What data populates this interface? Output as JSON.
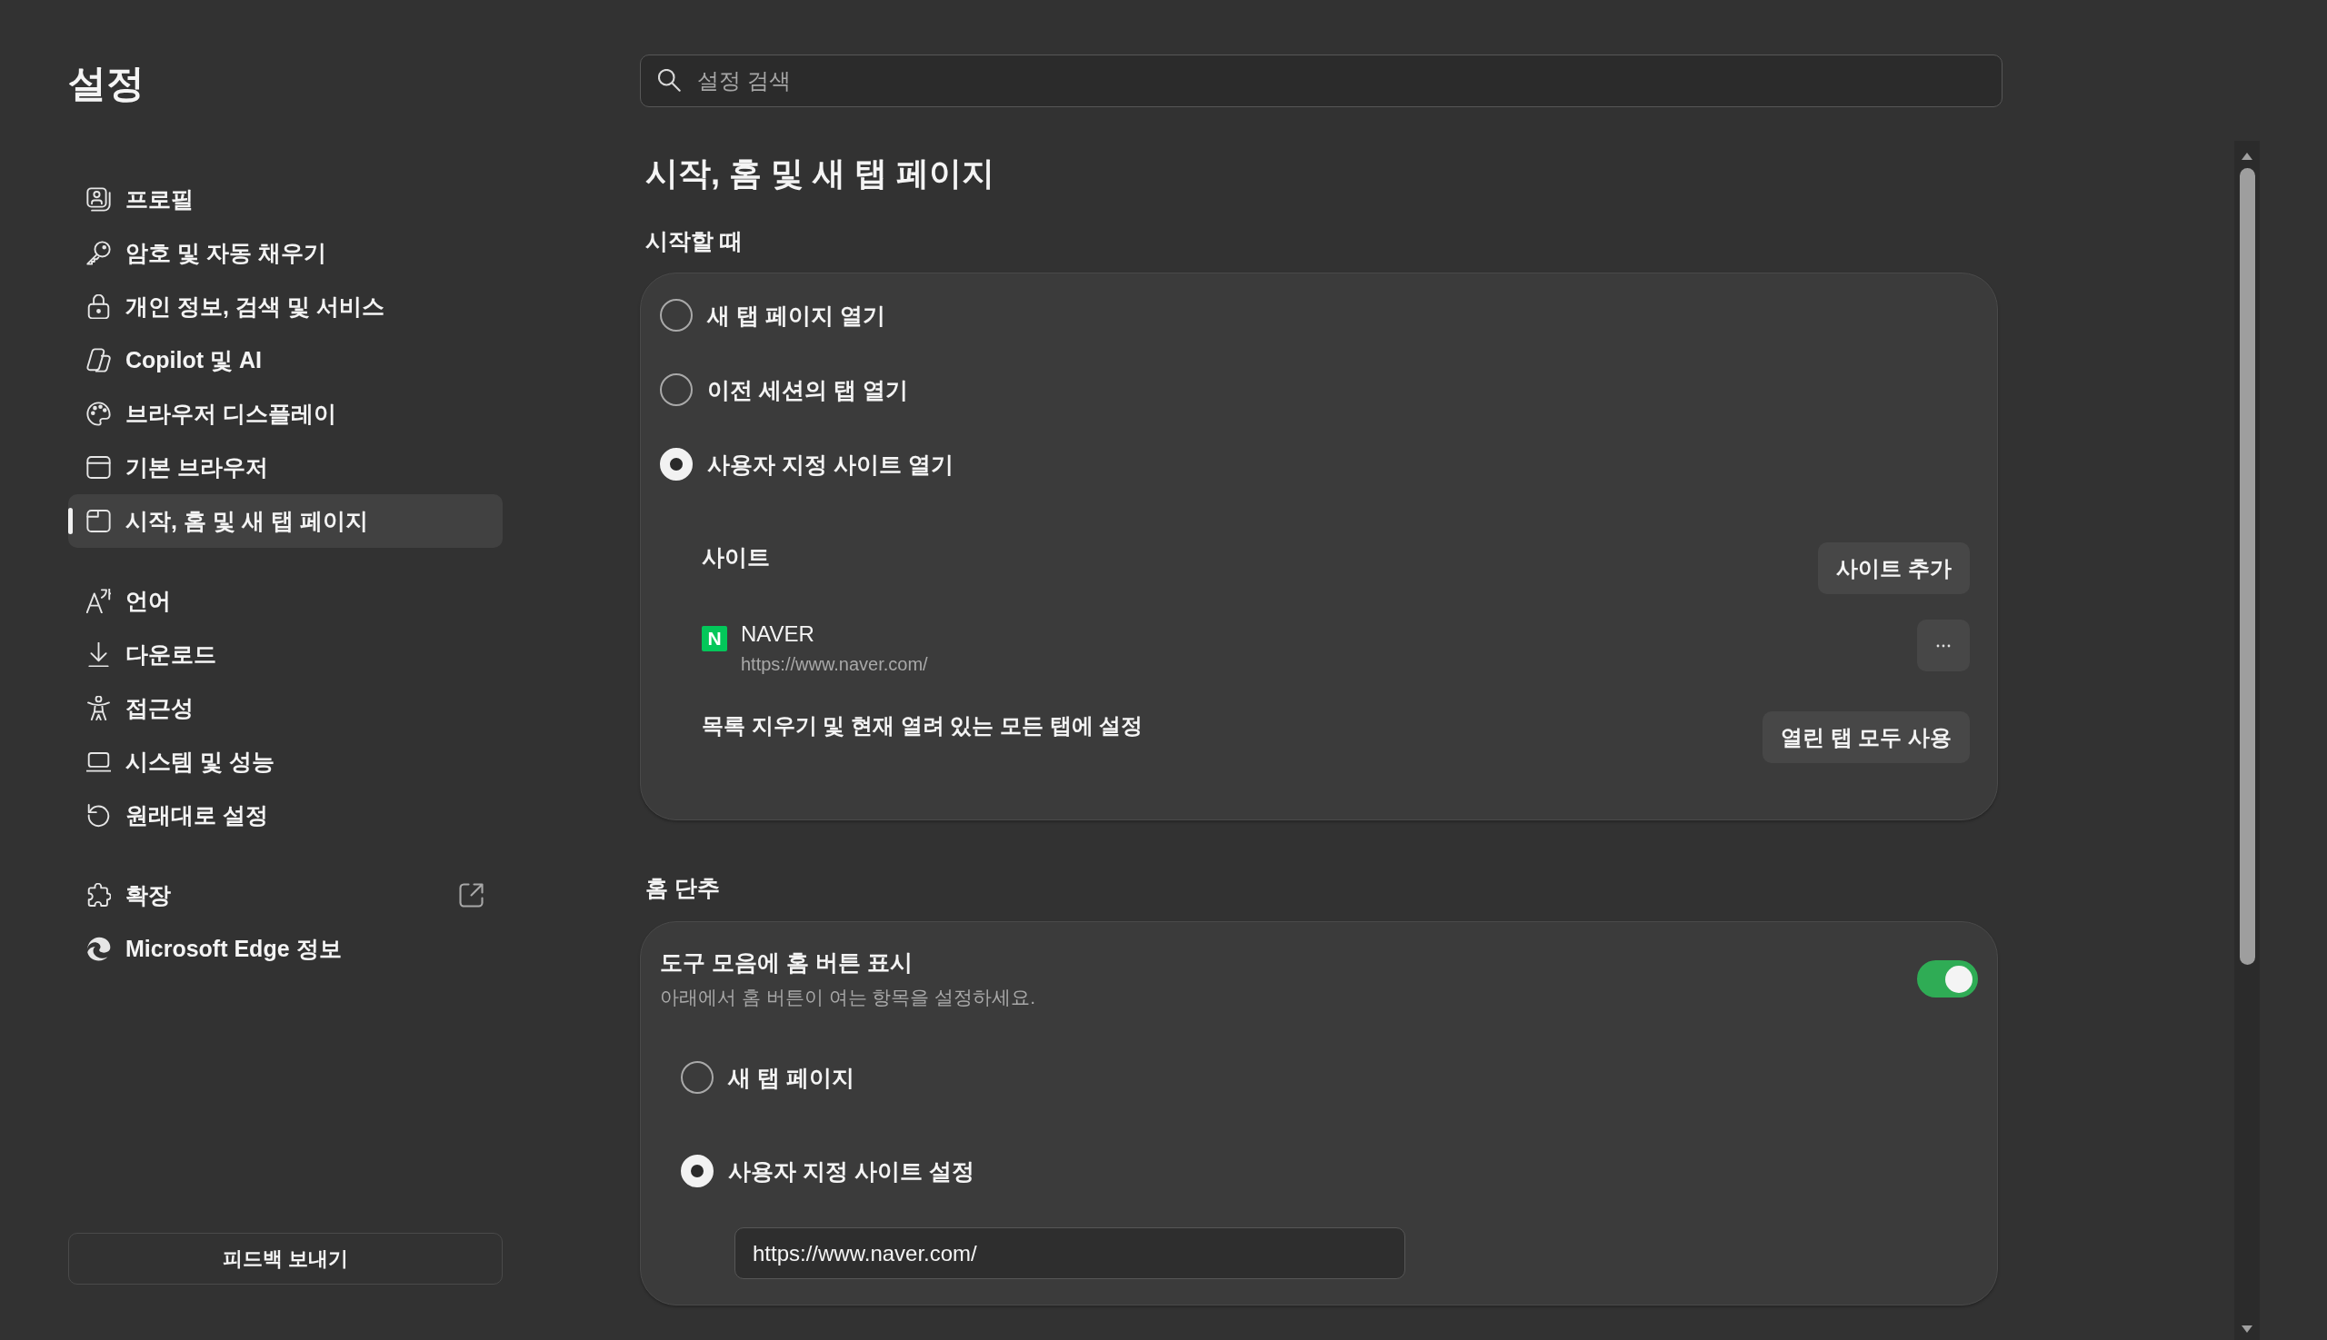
{
  "sidebar": {
    "title": "설정",
    "groups": [
      {
        "items": [
          {
            "label": "프로필",
            "selected": false,
            "external": false
          },
          {
            "label": "암호 및 자동 채우기",
            "selected": false,
            "external": false
          },
          {
            "label": "개인 정보, 검색 및 서비스",
            "selected": false,
            "external": false
          },
          {
            "label": "Copilot 및 AI",
            "selected": false,
            "external": false
          },
          {
            "label": "브라우저 디스플레이",
            "selected": false,
            "external": false
          },
          {
            "label": "기본 브라우저",
            "selected": false,
            "external": false
          },
          {
            "label": "시작, 홈 및 새 탭 페이지",
            "selected": true,
            "external": false
          }
        ]
      },
      {
        "items": [
          {
            "label": "언어",
            "selected": false,
            "external": false
          },
          {
            "label": "다운로드",
            "selected": false,
            "external": false
          },
          {
            "label": "접근성",
            "selected": false,
            "external": false
          },
          {
            "label": "시스템 및 성능",
            "selected": false,
            "external": false
          },
          {
            "label": "원래대로 설정",
            "selected": false,
            "external": false
          }
        ]
      },
      {
        "items": [
          {
            "label": "확장",
            "selected": false,
            "external": true
          },
          {
            "label": "Microsoft Edge 정보",
            "selected": false,
            "external": false
          }
        ]
      }
    ],
    "feedback_button": "피드백 보내기"
  },
  "search": {
    "placeholder": "설정 검색"
  },
  "page_title": "시작, 홈 및 새 탭 페이지",
  "startup": {
    "title": "시작할 때",
    "options": [
      {
        "label": "새 탭 페이지 열기",
        "selected": false
      },
      {
        "label": "이전 세션의 탭 열기",
        "selected": false
      },
      {
        "label": "사용자 지정 사이트 열기",
        "selected": true
      }
    ],
    "sites": {
      "title": "사이트",
      "add_button": "사이트 추가",
      "items": [
        {
          "favicon": "N",
          "name": "NAVER",
          "url": "https://www.naver.com/"
        }
      ],
      "clear_label": "목록 지우기 및 현재 열려 있는 모든 탭에 설정",
      "use_open_tabs_button": "열린 탭 모두 사용"
    }
  },
  "home_button": {
    "title": "홈 단추",
    "toggle": {
      "label": "도구 모음에 홈 버튼 표시",
      "description": "아래에서 홈 버튼이 여는 항목을 설정하세요.",
      "on": true
    },
    "options": [
      {
        "label": "새 탭 페이지",
        "selected": false
      },
      {
        "label": "사용자 지정 사이트 설정",
        "selected": true
      }
    ],
    "custom_url": {
      "value": "https://www.naver.com/"
    }
  }
}
